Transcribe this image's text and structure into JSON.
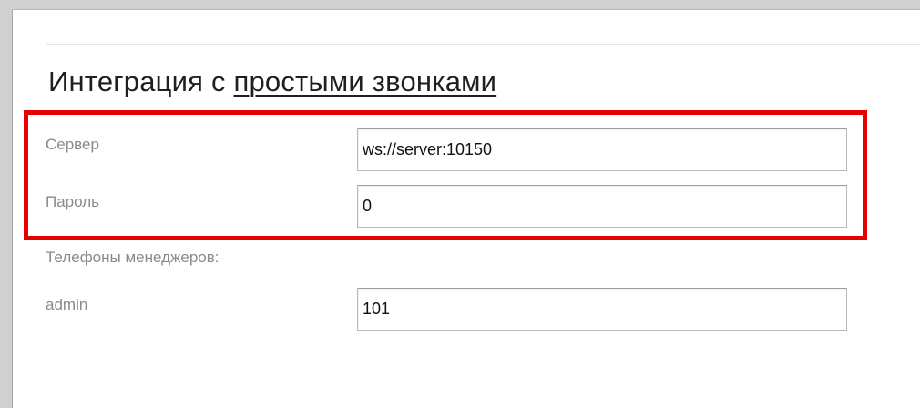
{
  "title": {
    "prefix": "Интеграция с ",
    "link": "простыми звонками"
  },
  "fields": {
    "server": {
      "label": "Сервер",
      "value": "ws://server:10150"
    },
    "password": {
      "label": "Пароль",
      "value": "0"
    }
  },
  "managers": {
    "heading": "Телефоны менеджеров:",
    "items": [
      {
        "label": "admin",
        "value": "101"
      }
    ]
  },
  "colors": {
    "highlight": "#e60000",
    "label": "#8a8a8a"
  }
}
